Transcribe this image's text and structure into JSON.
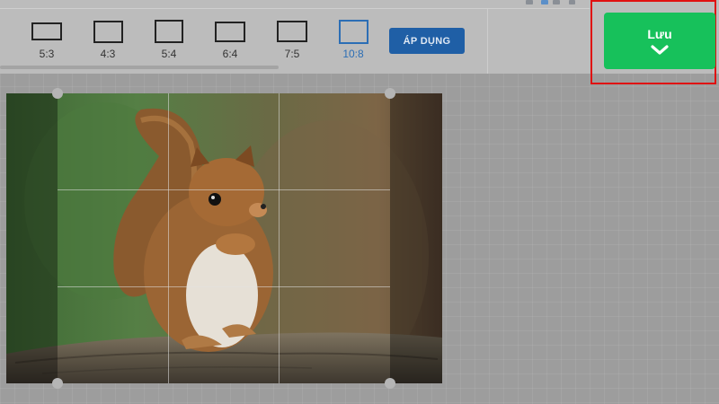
{
  "toolbar": {
    "ratios": [
      {
        "label": "5:3",
        "active": false
      },
      {
        "label": "4:3",
        "active": false
      },
      {
        "label": "5:4",
        "active": false
      },
      {
        "label": "6:4",
        "active": false
      },
      {
        "label": "7:5",
        "active": false
      },
      {
        "label": "10:8",
        "active": true
      }
    ],
    "apply_label": "ÁP DỤNG"
  },
  "save": {
    "label": "Lưu",
    "icon": "chevron-down-icon"
  },
  "editor": {
    "image_subject": "squirrel-photo",
    "crop_ratio": "10:8"
  },
  "colors": {
    "accent_blue": "#1f5fa6",
    "active_ratio": "#2c6eb5",
    "save_green": "#17c15b",
    "highlight_red": "#e01010"
  }
}
